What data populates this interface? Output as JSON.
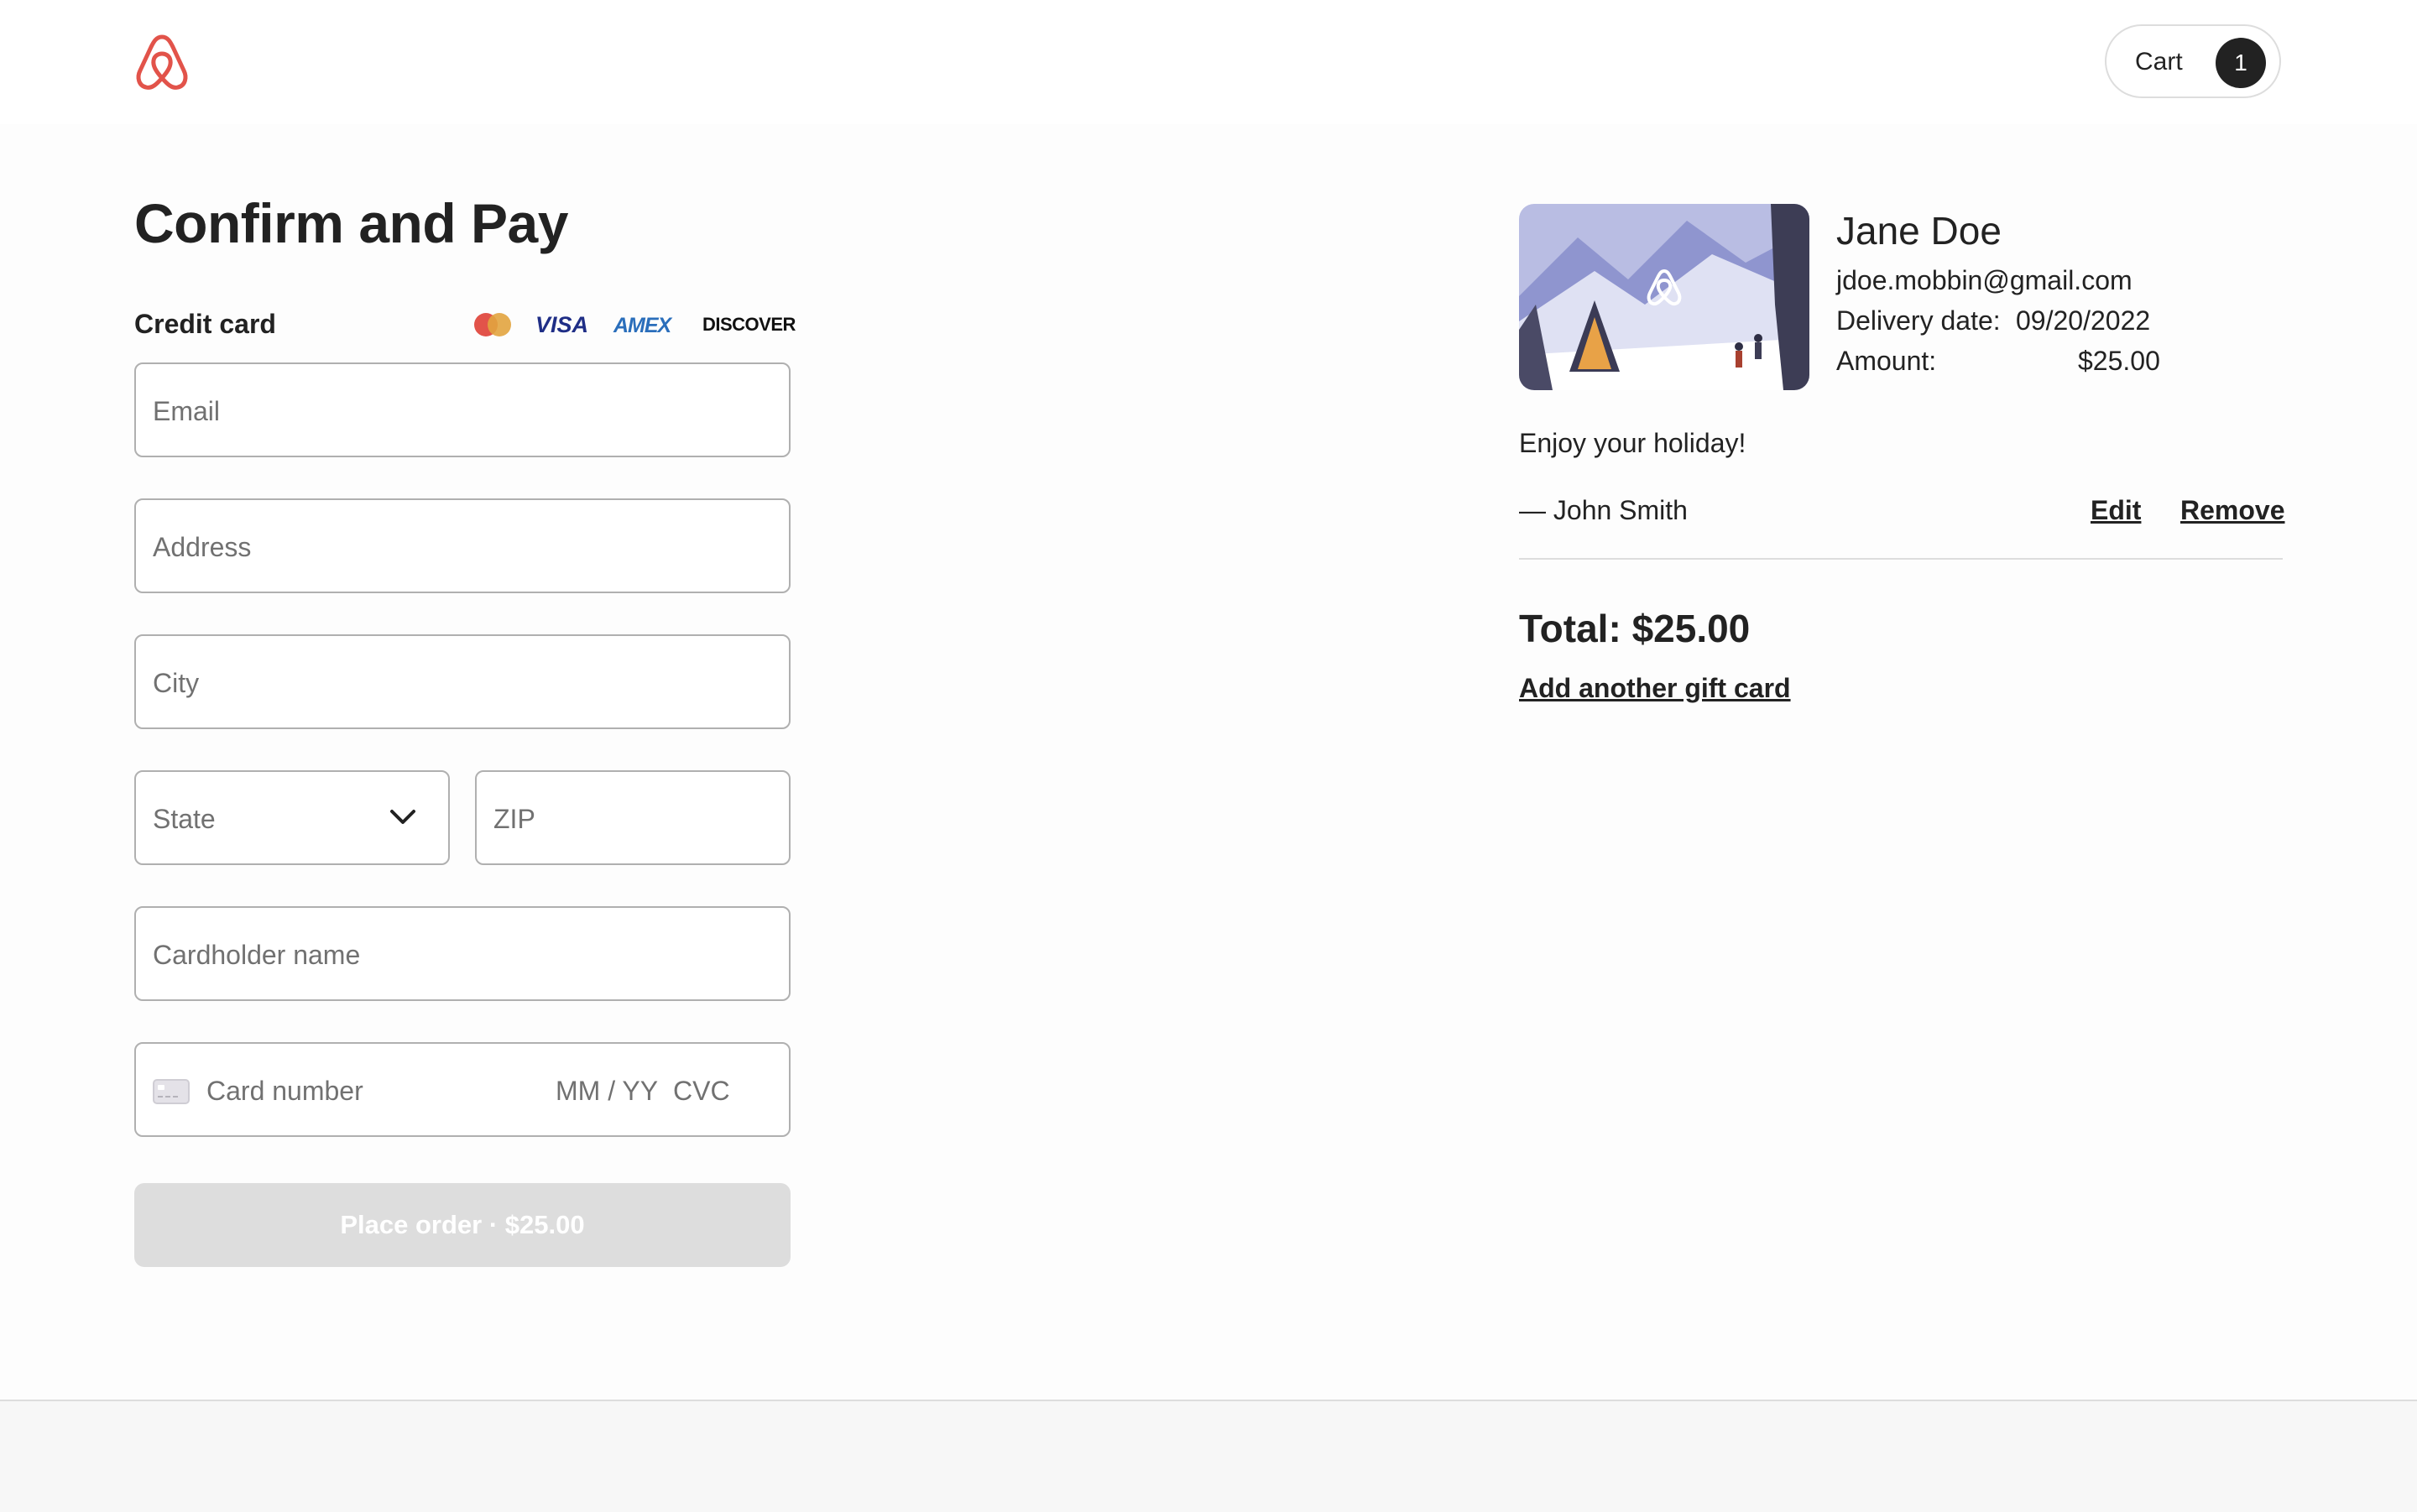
{
  "header": {
    "logo_icon": "airbnb-logo-icon",
    "brand_color": "#e2534a",
    "cart_label": "Cart",
    "cart_count": "1"
  },
  "checkout": {
    "title": "Confirm and Pay",
    "payment_method_label": "Credit card",
    "card_brands": [
      "Mastercard",
      "VISA",
      "AMEX",
      "DISCOVER"
    ],
    "fields": {
      "email_placeholder": "Email",
      "address_placeholder": "Address",
      "city_placeholder": "City",
      "state_placeholder": "State",
      "zip_placeholder": "ZIP",
      "cardholder_placeholder": "Cardholder name",
      "card_number_placeholder": "Card number",
      "expiry_placeholder": "MM / YY",
      "cvc_placeholder": "CVC"
    },
    "place_order_label": "Place order · $25.00"
  },
  "order": {
    "recipient_name": "Jane Doe",
    "recipient_email": "jdoe.mobbin@gmail.com",
    "delivery_label": "Delivery date:",
    "delivery_date": "09/20/2022",
    "amount_label": "Amount:",
    "amount": "$25.00",
    "message": "Enjoy your holiday!",
    "sender": "— John Smith",
    "edit_label": "Edit",
    "remove_label": "Remove",
    "total": "Total: $25.00",
    "add_another_label": "Add another gift card"
  }
}
